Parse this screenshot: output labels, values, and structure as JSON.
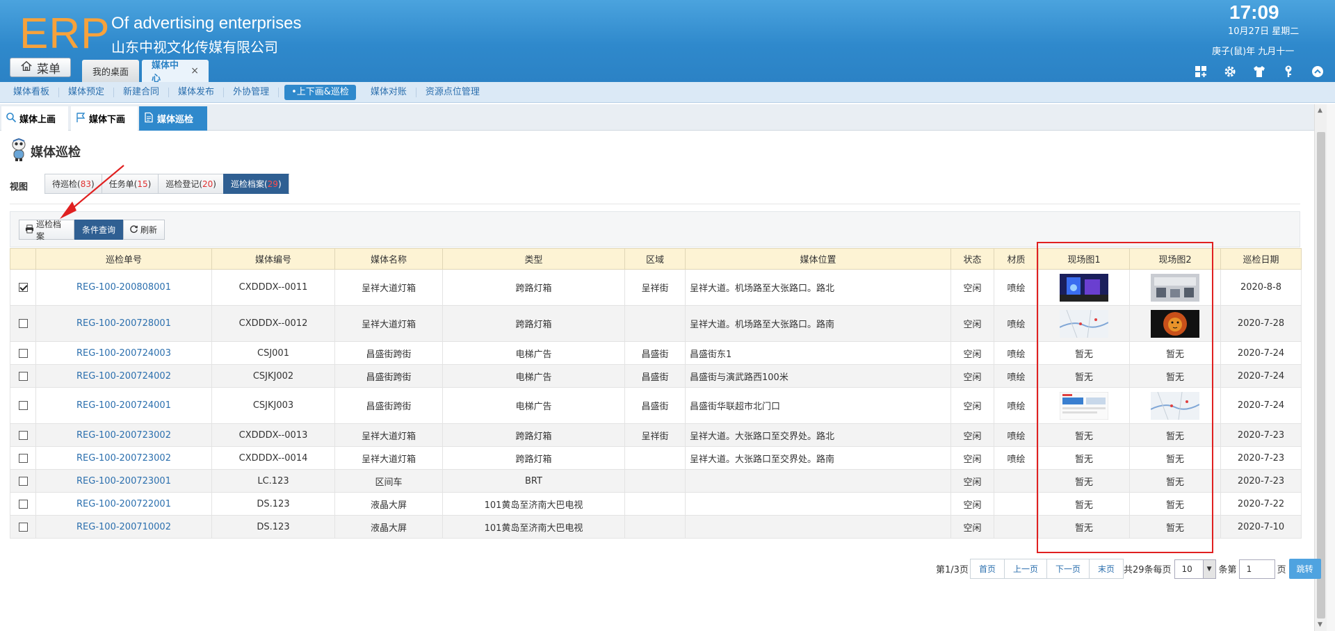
{
  "header": {
    "logo": "ERP",
    "app_title": "Of advertising enterprises",
    "company": "山东中视文化传媒有限公司",
    "time": "17:09",
    "date": "10月27日 星期二",
    "lunar": "庚子(鼠)年 九月十一",
    "menu_label": "菜单",
    "tabs": [
      {
        "label": "我的桌面"
      },
      {
        "label": "媒体中心",
        "close": "×"
      }
    ],
    "icons": [
      "grid-add-icon",
      "gear-icon",
      "shirt-icon",
      "key-icon",
      "collapse-up-icon"
    ]
  },
  "modnav": [
    "媒体看板",
    "媒体预定",
    "新建合同",
    "媒体发布",
    "外协管理",
    "•上下画&巡检",
    "媒体对账",
    "资源点位管理"
  ],
  "subtabs": [
    "媒体上画",
    "媒体下画",
    "媒体巡检"
  ],
  "page": {
    "title": "媒体巡检",
    "view_label": "视图",
    "view_tabs": [
      {
        "label": "待巡检(",
        "count": "83",
        "end": ")"
      },
      {
        "label": "任务单(",
        "count": "15",
        "end": ")"
      },
      {
        "label": "巡检登记(",
        "count": "20",
        "end": ")"
      },
      {
        "label": "巡检档案(",
        "count": "29",
        "end": ")"
      }
    ]
  },
  "toolbar": {
    "archive": "巡检档案",
    "query": "条件查询",
    "refresh": "刷新"
  },
  "table": {
    "columns": [
      "",
      "巡检单号",
      "媒体编号",
      "媒体名称",
      "类型",
      "区域",
      "媒体位置",
      "状态",
      "材质",
      "现场图1",
      "现场图2",
      "巡检日期"
    ],
    "rows": [
      {
        "checked": true,
        "code": "REG-100-200808001",
        "media_no": "CXDDDX--0011",
        "name": "呈祥大道灯箱",
        "type": "跨路灯箱",
        "area": "呈祥街",
        "location": "呈祥大道。机场路至大张路口。路北",
        "status": "空闲",
        "material": "喷绘",
        "img1": "photo-blue",
        "img2": "photo-gray",
        "date": "2020-8-8"
      },
      {
        "checked": false,
        "code": "REG-100-200728001",
        "media_no": "CXDDDX--0012",
        "name": "呈祥大道灯箱",
        "type": "跨路灯箱",
        "area": "",
        "location": "呈祥大道。机场路至大张路口。路南",
        "status": "空闲",
        "material": "喷绘",
        "img1": "photo-map",
        "img2": "photo-lion",
        "date": "2020-7-28"
      },
      {
        "checked": false,
        "code": "REG-100-200724003",
        "media_no": "CSJ001",
        "name": "昌盛街跨街",
        "type": "电梯广告",
        "area": "昌盛街",
        "location": "昌盛街东1",
        "status": "空闲",
        "material": "喷绘",
        "img1_text": "暂无",
        "img2_text": "暂无",
        "date": "2020-7-24"
      },
      {
        "checked": false,
        "code": "REG-100-200724002",
        "media_no": "CSJKJ002",
        "name": "昌盛街跨街",
        "type": "电梯广告",
        "area": "昌盛街",
        "location": "昌盛街与演武路西100米",
        "status": "空闲",
        "material": "喷绘",
        "img1_text": "暂无",
        "img2_text": "暂无",
        "date": "2020-7-24"
      },
      {
        "checked": false,
        "code": "REG-100-200724001",
        "media_no": "CSJKJ003",
        "name": "昌盛街跨街",
        "type": "电梯广告",
        "area": "昌盛街",
        "location": "昌盛街华联超市北门口",
        "status": "空闲",
        "material": "喷绘",
        "img1": "photo-web",
        "img2": "photo-map",
        "date": "2020-7-24"
      },
      {
        "checked": false,
        "code": "REG-100-200723002",
        "media_no": "CXDDDX--0013",
        "name": "呈祥大道灯箱",
        "type": "跨路灯箱",
        "area": "呈祥街",
        "location": "呈祥大道。大张路口至交界处。路北",
        "status": "空闲",
        "material": "喷绘",
        "img1_text": "暂无",
        "img2_text": "暂无",
        "date": "2020-7-23"
      },
      {
        "checked": false,
        "code": "REG-100-200723002",
        "media_no": "CXDDDX--0014",
        "name": "呈祥大道灯箱",
        "type": "跨路灯箱",
        "area": "",
        "location": "呈祥大道。大张路口至交界处。路南",
        "status": "空闲",
        "material": "喷绘",
        "img1_text": "暂无",
        "img2_text": "暂无",
        "date": "2020-7-23"
      },
      {
        "checked": false,
        "code": "REG-100-200723001",
        "media_no": "LC.123",
        "name": "区间车",
        "type": "BRT",
        "area": "",
        "location": "",
        "status": "空闲",
        "material": "",
        "img1_text": "暂无",
        "img2_text": "暂无",
        "date": "2020-7-23"
      },
      {
        "checked": false,
        "code": "REG-100-200722001",
        "media_no": "DS.123",
        "name": "液晶大屏",
        "type": "101黄岛至济南大巴电视",
        "area": "",
        "location": "",
        "status": "空闲",
        "material": "",
        "img1_text": "暂无",
        "img2_text": "暂无",
        "date": "2020-7-22"
      },
      {
        "checked": false,
        "code": "REG-100-200710002",
        "media_no": "DS.123",
        "name": "液晶大屏",
        "type": "101黄岛至济南大巴电视",
        "area": "",
        "location": "",
        "status": "空闲",
        "material": "",
        "img1_text": "暂无",
        "img2_text": "暂无",
        "date": "2020-7-10"
      }
    ]
  },
  "pager": {
    "info": "第1/3页",
    "first": "首页",
    "prev": "上一页",
    "next": "下一页",
    "last": "末页",
    "total": "共29条每页",
    "page_size": "10",
    "per": "条第",
    "page_input": "1",
    "page_unit": "页",
    "go": "跳转"
  },
  "colors": {
    "header_blue": "#2f89cc",
    "logo_orange": "#f7a23b",
    "link_blue": "#2b6fae",
    "count_red": "#e03030",
    "highlight_red": "#e02020"
  }
}
